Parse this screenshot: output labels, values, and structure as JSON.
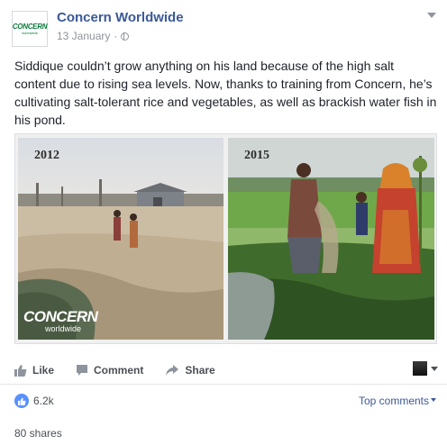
{
  "page": {
    "name": "Concern Worldwide",
    "avatar_text": "CONCERN",
    "avatar_subtext": "worldwide",
    "date": "13 January",
    "separator": "·",
    "privacy_icon": "globe-icon",
    "options_icon": "chevron-down-icon"
  },
  "post": {
    "text": "Siddique couldn’t grow anything on his land because of the high salt content due to rising sea levels. Now, thanks to training from Concern, he’s cultivating salt-tolerant rice and vegetables, as well as brackish water fish in his pond."
  },
  "image": {
    "left_year": "2012",
    "right_year": "2015",
    "logo_main": "CONCERN",
    "logo_sub": "worldwide"
  },
  "actions": {
    "like": "Like",
    "comment": "Comment",
    "share": "Share",
    "like_icon": "thumbs-up-icon",
    "comment_icon": "speech-bubble-icon",
    "share_icon": "share-arrow-icon"
  },
  "reactions": {
    "like_count": "6.2k",
    "sort_label": "Top comments",
    "shares": "80 shares"
  },
  "colors": {
    "link": "#3b5998",
    "like_badge": "#5890ff",
    "brand_green": "#0a7a3c"
  }
}
